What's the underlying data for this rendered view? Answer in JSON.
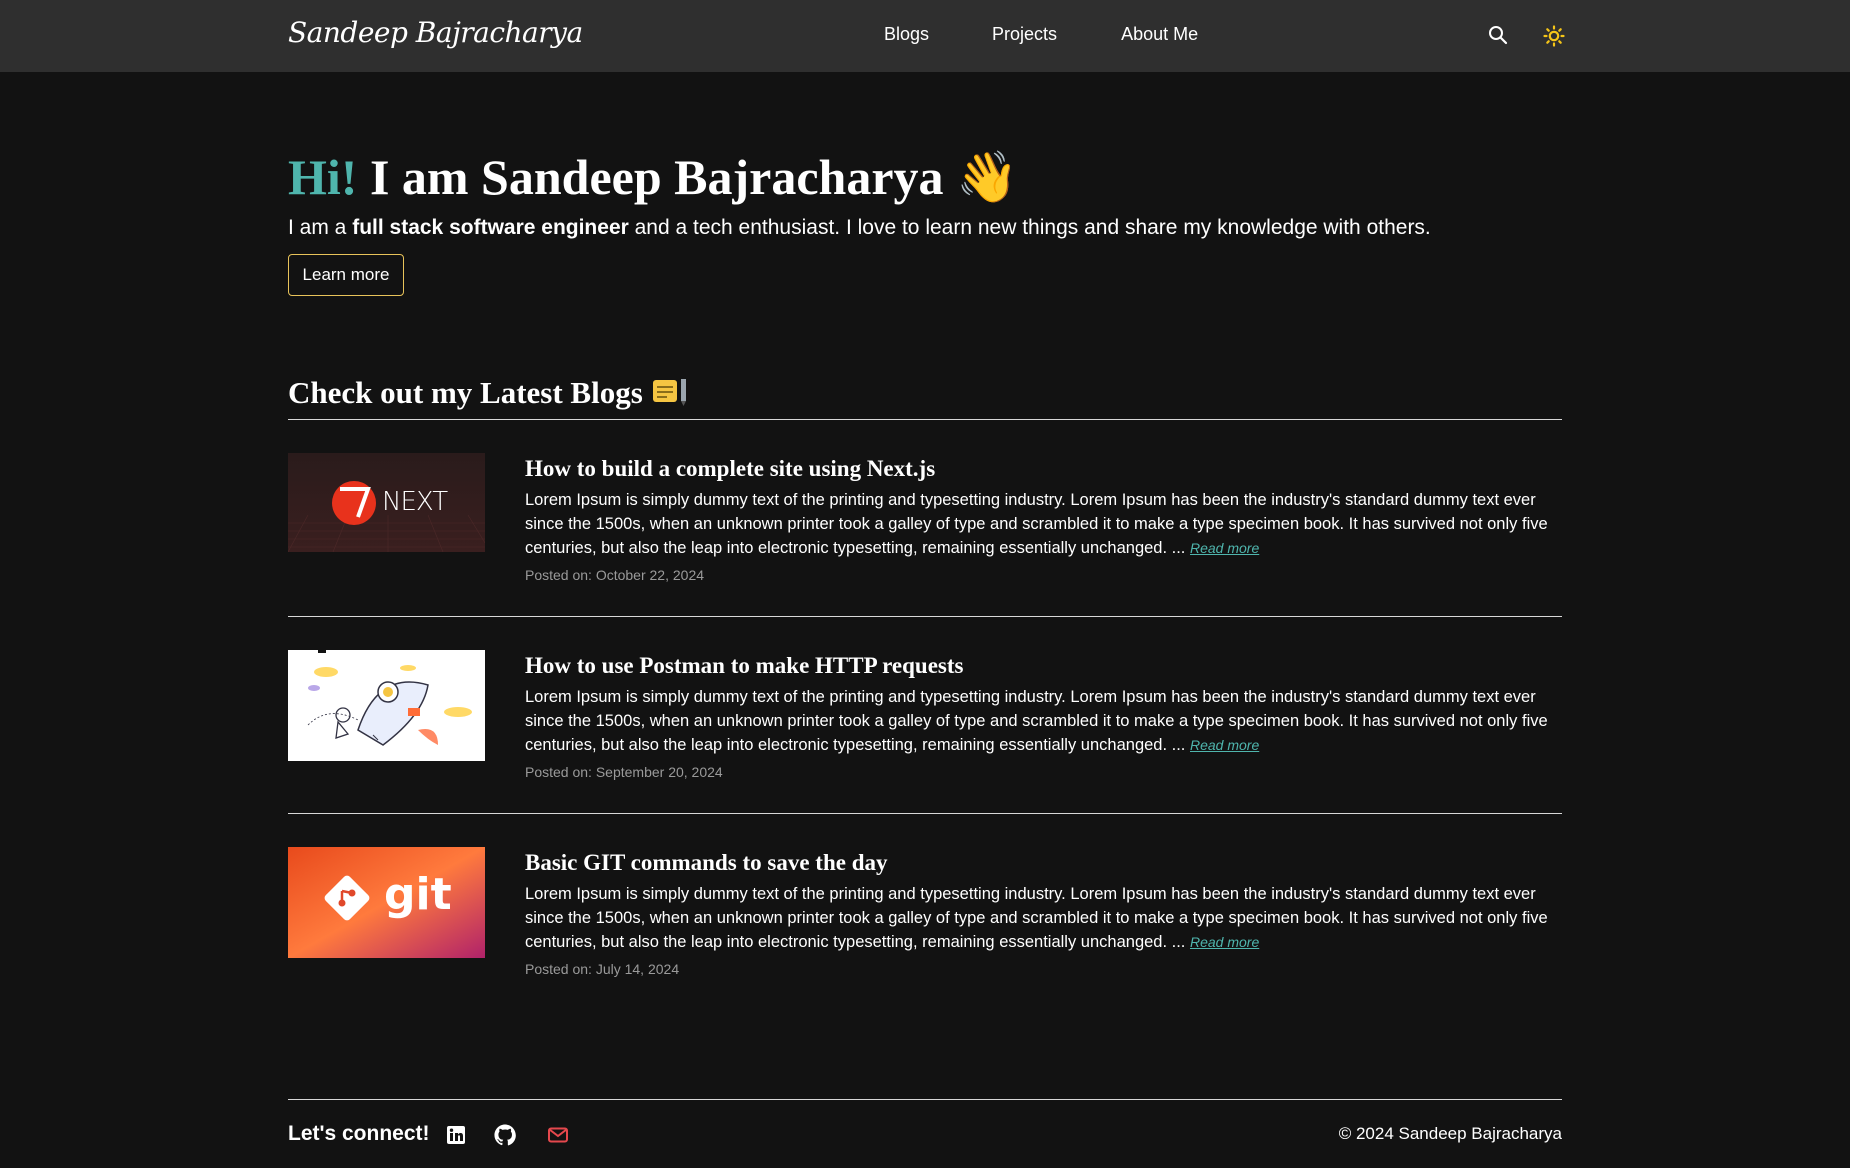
{
  "header": {
    "logo": "Sandeep Bajracharya",
    "nav": [
      "Blogs",
      "Projects",
      "About Me"
    ],
    "search_icon": "search-icon",
    "theme_icon": "sun-icon",
    "theme_color": "#f5c518"
  },
  "hero": {
    "greeting": "Hi!",
    "title": " I am Sandeep Bajracharya ",
    "emoji": "👋",
    "sub_prefix": "I am a ",
    "sub_bold": "full stack software engineer",
    "sub_suffix": " and a tech enthusiast. I love to learn new things and share my knowledge with others.",
    "button": "Learn more"
  },
  "blogs": {
    "heading": "Check out my Latest Blogs ",
    "heading_icon": "memo-icon",
    "read_more": "Read more",
    "posts": [
      {
        "title": "How to build a complete site using Next.js",
        "excerpt": "Lorem Ipsum is simply dummy text of the printing and typesetting industry. Lorem Ipsum has been the industry's standard dummy text ever since the 1500s, when an unknown printer took a galley of type and scrambled it to make a type specimen book. It has survived not only five centuries, but also the leap into electronic typesetting, remaining essentially unchanged. ... ",
        "date": "Posted on: October 22, 2024",
        "thumb_text": "NEXT"
      },
      {
        "title": "How to use Postman to make HTTP requests",
        "excerpt": "Lorem Ipsum is simply dummy text of the printing and typesetting industry. Lorem Ipsum has been the industry's standard dummy text ever since the 1500s, when an unknown printer took a galley of type and scrambled it to make a type specimen book. It has survived not only five centuries, but also the leap into electronic typesetting, remaining essentially unchanged. ... ",
        "date": "Posted on: September 20, 2024",
        "thumb_text": ""
      },
      {
        "title": "Basic GIT commands to save the day",
        "excerpt": "Lorem Ipsum is simply dummy text of the printing and typesetting industry. Lorem Ipsum has been the industry's standard dummy text ever since the 1500s, when an unknown printer took a galley of type and scrambled it to make a type specimen book. It has survived not only five centuries, but also the leap into electronic typesetting, remaining essentially unchanged. ... ",
        "date": "Posted on: July 14, 2024",
        "thumb_text": "git"
      }
    ]
  },
  "footer": {
    "connect": "Let's connect!",
    "social_icons": [
      "linkedin-icon",
      "github-icon",
      "mail-icon"
    ],
    "copyright": "© 2024 Sandeep Bajracharya",
    "mail_color": "#e5484d"
  },
  "colors": {
    "accent": "#4fb5ad",
    "button_border": "#e8c35a",
    "background": "#121212",
    "header_bg": "#2f2f2f"
  }
}
